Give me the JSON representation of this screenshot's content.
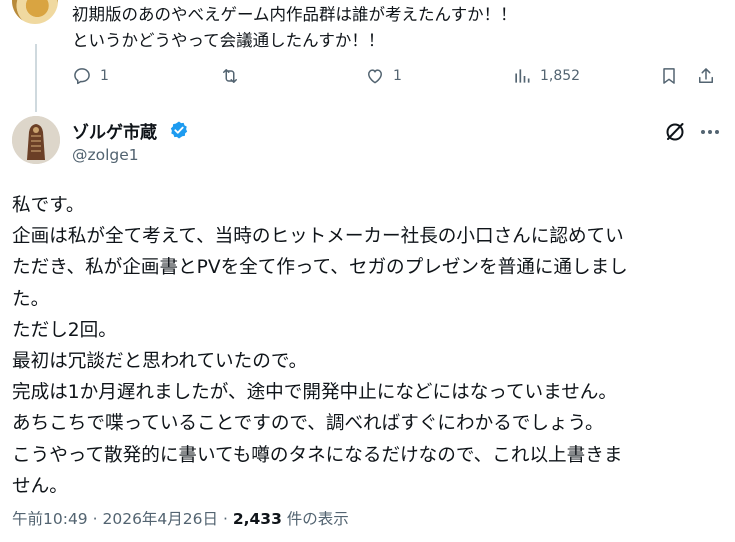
{
  "previous_reply": {
    "lines": [
      "初期版のあのやべえゲーム内作品群は誰が考えたんすか！！",
      "というかどうやって会議通したんすか！！"
    ],
    "actions": {
      "reply_count": "1",
      "retweet_count": "",
      "like_count": "1",
      "view_count": "1,852"
    }
  },
  "post": {
    "display_name": "ゾルゲ市蔵",
    "handle": "@zolge1",
    "body_lines": [
      "私です。",
      "企画は私が全て考えて、当時のヒットメーカー社長の小口さんに認めてい",
      "ただき、私が企画書とPVを全て作って、セガのプレゼンを普通に通しまし",
      "た。",
      "ただし2回。",
      "最初は冗談だと思われていたので。",
      "完成は1か月遅れましたが、途中で開発中止になどにはなっていません。",
      "あちこちで喋っていることですので、調べればすぐにわかるでしょう。",
      "こうやって散発的に書いても噂のタネになるだけなので、これ以上書きま",
      "せん。"
    ],
    "time": "午前10:49",
    "date": "2026年4月26日",
    "separator": "·",
    "views_number": "2,433",
    "views_suffix": "件の表示"
  },
  "colors": {
    "text": "#0f1419",
    "secondary": "#536471",
    "verified": "#1d9bf0",
    "thread_line": "#cfd9de"
  }
}
